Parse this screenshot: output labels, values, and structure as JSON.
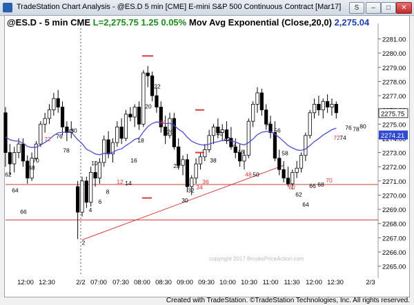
{
  "window": {
    "title": "TradeStation Chart Analysis - @ES.D 5 min [CME] E-mini S&P 500 Continuous Contract [Mar17]",
    "footer": "Created with TradeStation. ©TradeStation Technologies, Inc. All rights reserved."
  },
  "header": {
    "symbol": "@ES.D - 5 min  CME",
    "last": "L=2,275.75",
    "change": "1.25",
    "pct": "0.05%",
    "study": "Mov Avg Exponential (Close,20,0)",
    "study_value": "2,275.04"
  },
  "colors": {
    "up_bar": "#ffffff",
    "down_bar": "#000000",
    "ema": "#4b4bd6",
    "current_price_tag": "#2b5cc8",
    "ema_tag": "#2f49d0",
    "support_line": "#d43b3b",
    "bar_number_red": "#d43b3b"
  },
  "chart_data": {
    "type": "candlestick",
    "y_ticks": [
      2265,
      2266,
      2267,
      2268,
      2269,
      2270,
      2271,
      2272,
      2273,
      2274,
      2275,
      2276,
      2277,
      2278,
      2279,
      2280,
      2281
    ],
    "y_tick_labels": [
      "2265.00",
      "2266.00",
      "2267.00",
      "2268.00",
      "2269.00",
      "2270.00",
      "2271.00",
      "2272.00",
      "2273.00",
      "2274.00",
      "2275.00",
      "2276.00",
      "2277.00",
      "2278.00",
      "2279.00",
      "2280.00",
      "2281.00"
    ],
    "ylim": [
      2264.35,
      2281.8
    ],
    "x_tick_labels": [
      "12:00",
      "12:30",
      "2/2",
      "07:00",
      "07:30",
      "08:00",
      "08:30",
      "09:00",
      "09:30",
      "10:00",
      "10:30",
      "11:00",
      "11:30",
      "12:00",
      "12:30",
      "2/3"
    ],
    "current_price": "2275.75",
    "ema_value": "2274.21",
    "horizontal_lines": [
      2270.75,
      2268.25
    ],
    "trendline": {
      "from": [
        2,
        2266.85
      ],
      "to": [
        48,
        2272.1
      ]
    },
    "watermark": "copyright 2017 BrooksPriceAction.com",
    "bar_numbers": [
      {
        "bar": 2,
        "label": "2",
        "color": "black"
      },
      {
        "bar": 4,
        "label": "4",
        "color": "black"
      },
      {
        "bar": 6,
        "label": "6",
        "color": "black"
      },
      {
        "bar": 8,
        "label": "8",
        "color": "black"
      },
      {
        "bar": 10,
        "label": "10",
        "color": "black"
      },
      {
        "bar": 12,
        "label": "12",
        "color": "red"
      },
      {
        "bar": 14,
        "label": "14",
        "color": "black"
      },
      {
        "bar": 16,
        "label": "16",
        "color": "black"
      },
      {
        "bar": 18,
        "label": "18",
        "color": "black"
      },
      {
        "bar": 20,
        "label": "20",
        "color": "black"
      },
      {
        "bar": 22,
        "label": "22",
        "color": "black"
      },
      {
        "bar": 24,
        "label": "24",
        "color": "red"
      },
      {
        "bar": 26,
        "label": "26",
        "color": "black"
      },
      {
        "bar": 28,
        "label": "28",
        "color": "black"
      },
      {
        "bar": 30,
        "label": "30",
        "color": "black"
      },
      {
        "bar": 32,
        "label": "32",
        "color": "black"
      },
      {
        "bar": 34,
        "label": "34",
        "color": "red"
      },
      {
        "bar": 36,
        "label": "36",
        "color": "red"
      },
      {
        "bar": 38,
        "label": "38",
        "color": "black"
      },
      {
        "bar": 40,
        "label": "40",
        "color": "black"
      },
      {
        "bar": 42,
        "label": "42",
        "color": "black"
      },
      {
        "bar": 44,
        "label": "44",
        "color": "black"
      },
      {
        "bar": 46,
        "label": "46",
        "color": "black"
      },
      {
        "bar": 48,
        "label": "48",
        "color": "red"
      },
      {
        "bar": 50,
        "label": "50",
        "color": "black"
      },
      {
        "bar": 54,
        "label": "54",
        "color": "black"
      },
      {
        "bar": 56,
        "label": "56",
        "color": "black"
      },
      {
        "bar": 58,
        "label": "58",
        "color": "black"
      },
      {
        "bar": 60,
        "label": "60",
        "color": "red"
      },
      {
        "bar": 62,
        "label": "62",
        "color": "black"
      },
      {
        "bar": 64,
        "label": "64",
        "color": "black"
      },
      {
        "bar": 66,
        "label": "66",
        "color": "black"
      },
      {
        "bar": 68,
        "label": "68",
        "color": "black"
      },
      {
        "bar": 70,
        "label": "70",
        "color": "red"
      },
      {
        "bar": 72,
        "label": "72",
        "color": "red"
      },
      {
        "bar": 74,
        "label": "74",
        "color": "black"
      },
      {
        "bar": 76,
        "label": "76",
        "color": "black"
      },
      {
        "bar": 78,
        "label": "78",
        "color": "black"
      },
      {
        "bar": 80,
        "label": "80",
        "color": "black"
      },
      {
        "bar": null,
        "label": "62",
        "color": "black"
      },
      {
        "bar": null,
        "label": "64",
        "color": "black"
      },
      {
        "bar": null,
        "label": "66",
        "color": "black"
      },
      {
        "bar": null,
        "label": "68",
        "color": "black"
      },
      {
        "bar": null,
        "label": "70",
        "color": "black"
      },
      {
        "bar": null,
        "label": "72",
        "color": "red"
      },
      {
        "bar": null,
        "label": "76",
        "color": "black"
      },
      {
        "bar": null,
        "label": "78",
        "color": "black"
      },
      {
        "bar": null,
        "label": "80",
        "color": "black"
      }
    ]
  }
}
